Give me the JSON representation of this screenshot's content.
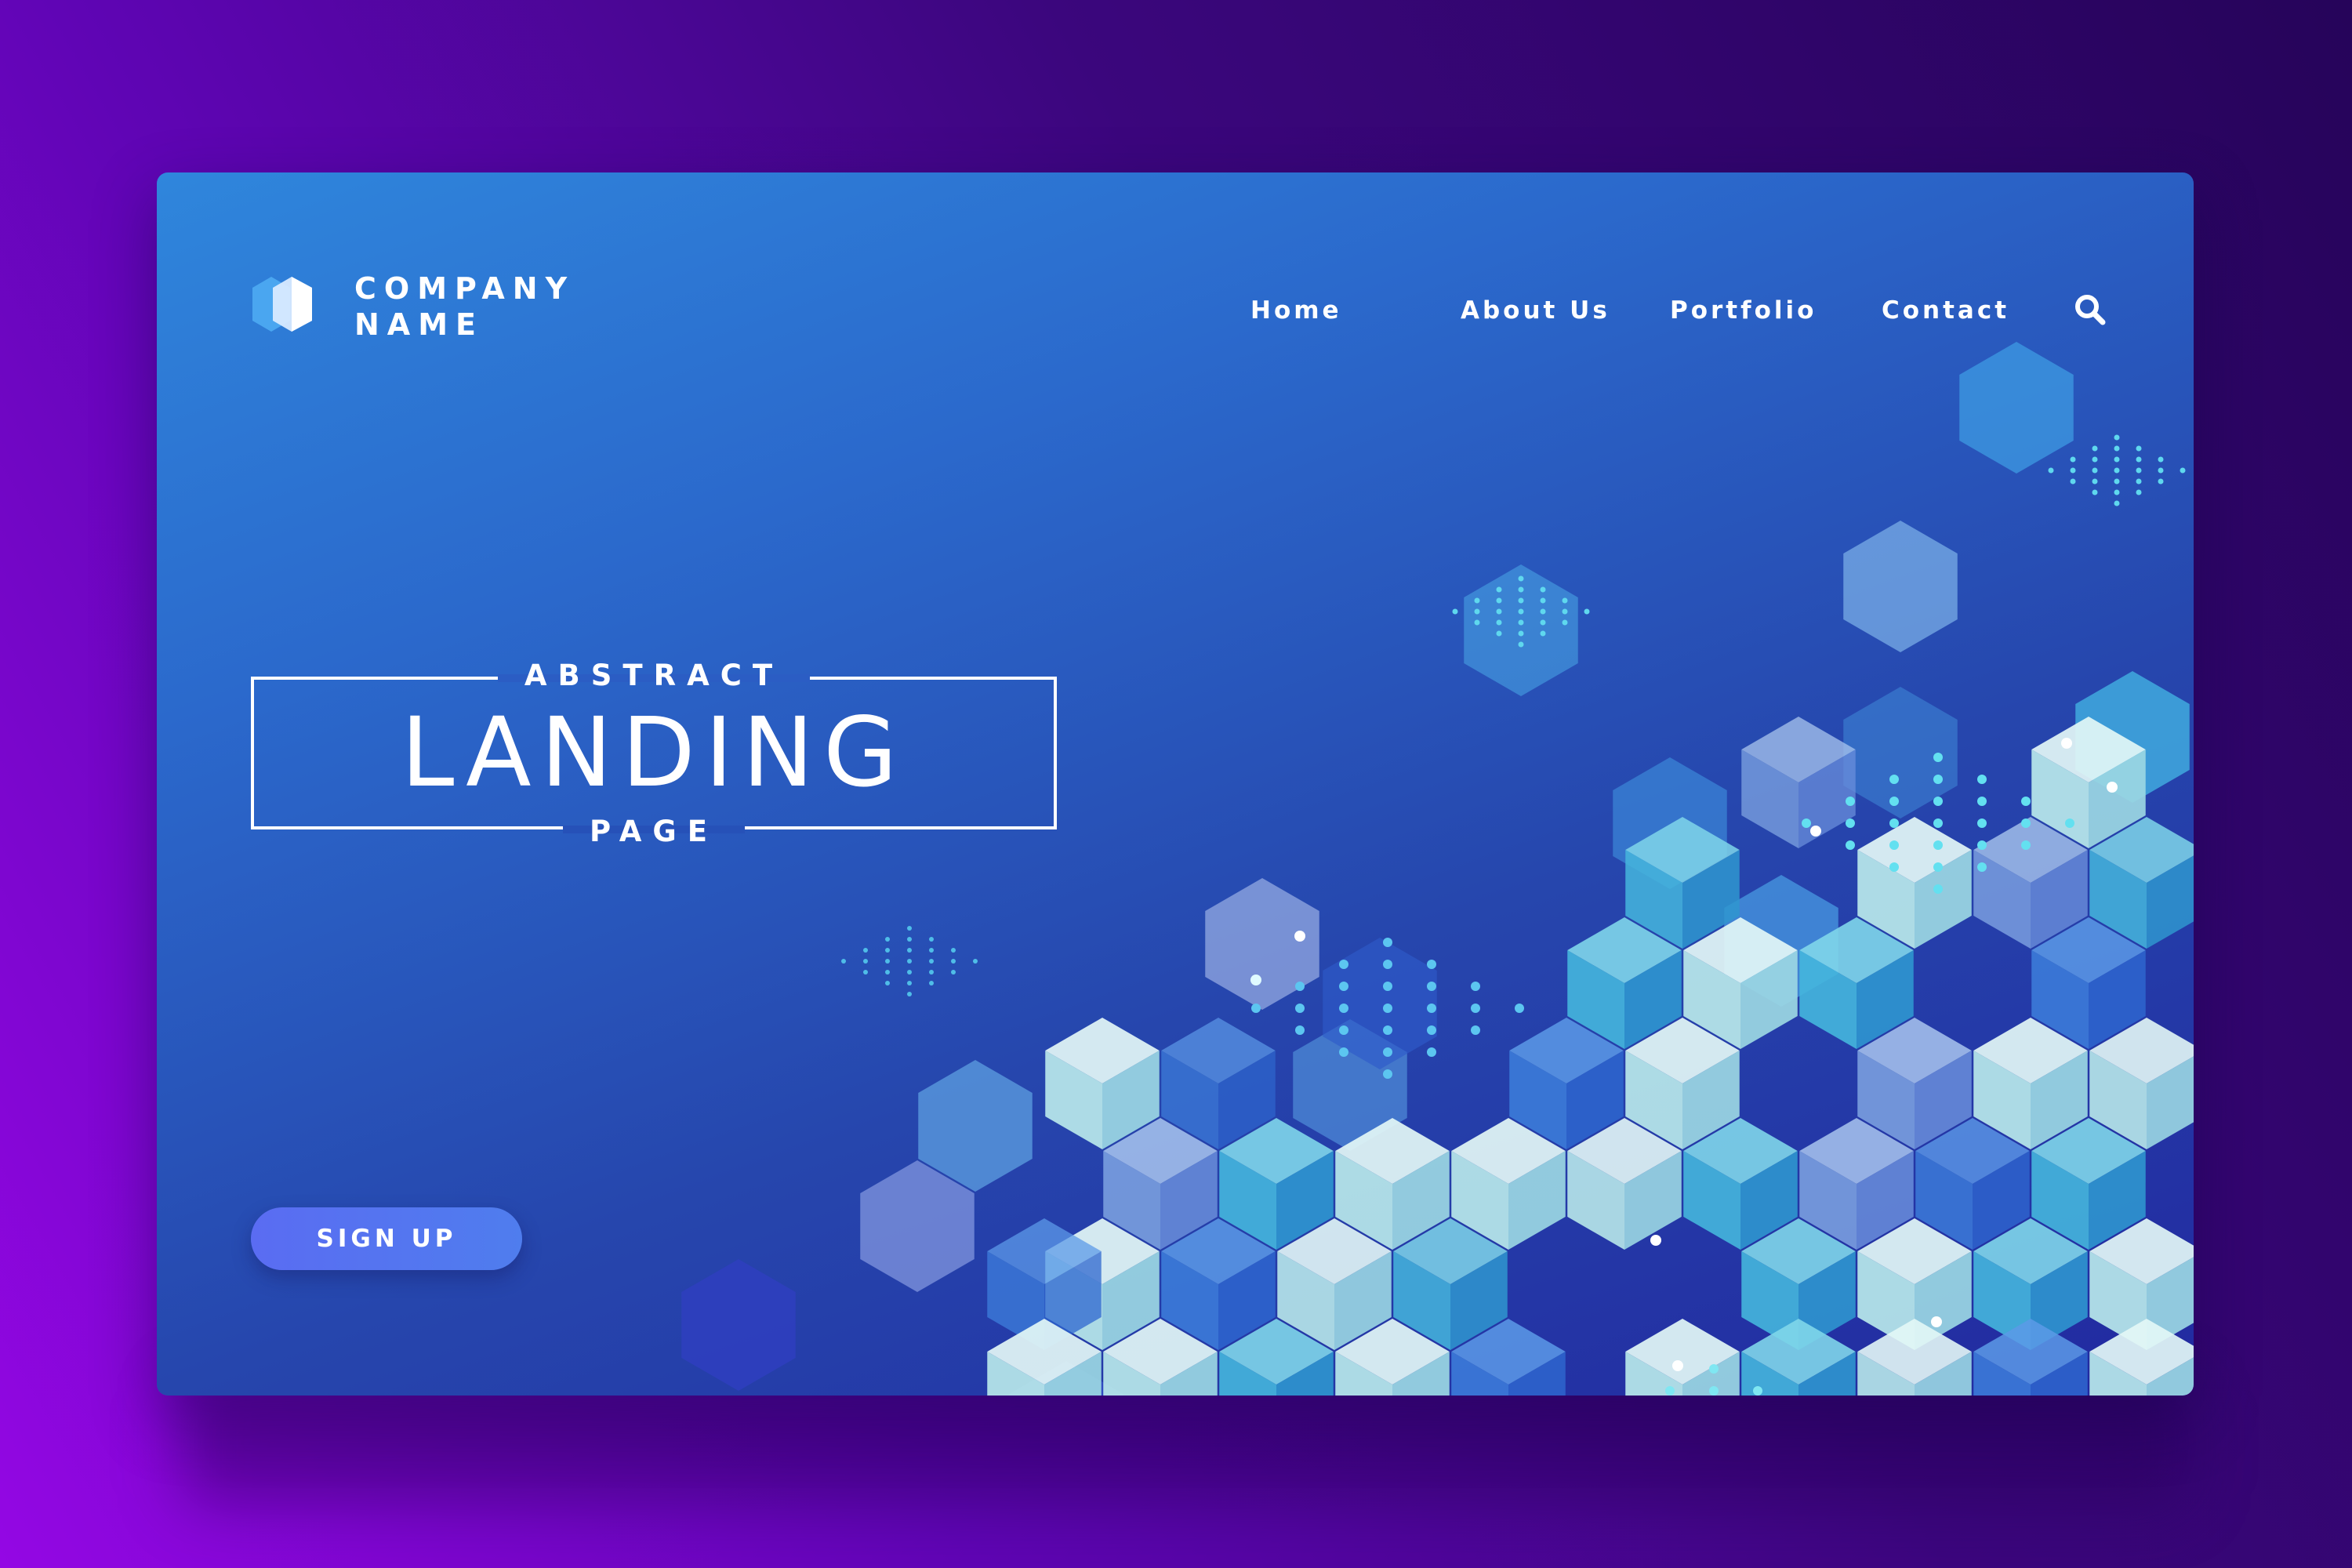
{
  "brand": {
    "line1": "COMPANY",
    "line2": "NAME",
    "logo_icon": "hexagon-logo-icon"
  },
  "nav": {
    "items": [
      {
        "label": "Home"
      },
      {
        "label": "About Us"
      },
      {
        "label": "Portfolio"
      },
      {
        "label": "Contact"
      }
    ],
    "search_icon": "search-icon"
  },
  "hero": {
    "top_label": "ABSTRACT",
    "title": "LANDING",
    "bottom_label": "PAGE"
  },
  "cta": {
    "label": "SIGN UP"
  },
  "colors": {
    "background_start": "#9407e4",
    "background_end": "#26045a",
    "card_top": "#2f86dc",
    "card_bottom": "#2229a0",
    "button": "#5a6cf2",
    "hex_light": "#d6f4f4",
    "hex_cyan": "#4fc2e0",
    "dot_cyan": "#7fe7f2"
  }
}
